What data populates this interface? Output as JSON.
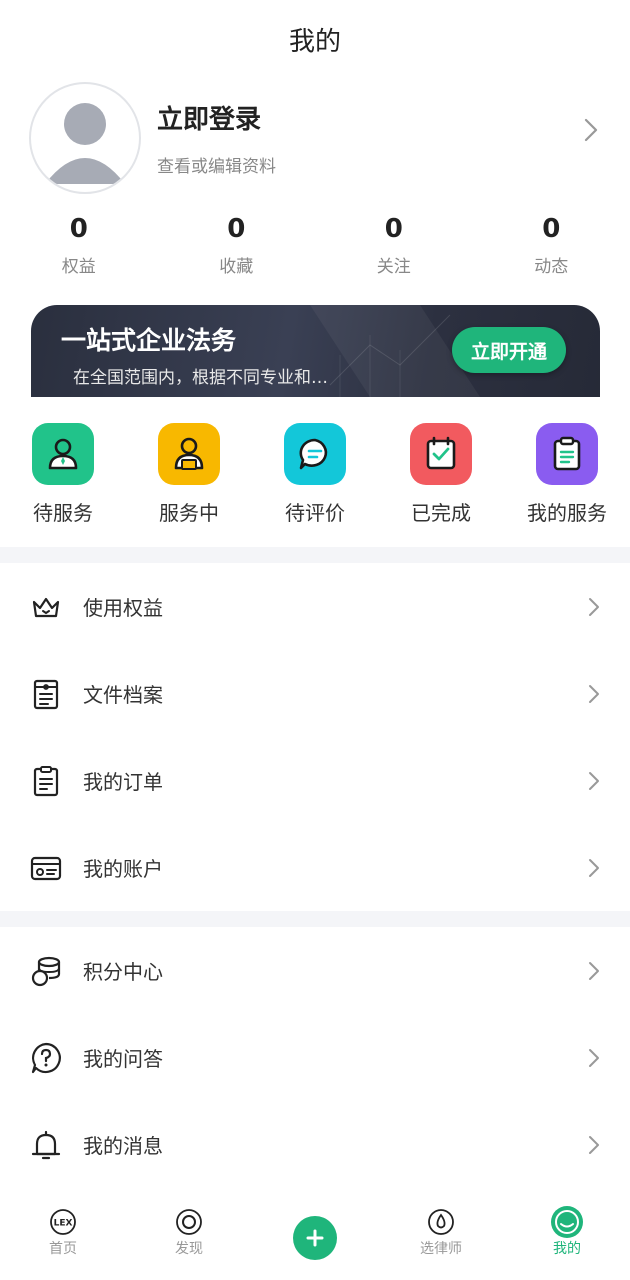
{
  "header": {
    "title": "我的"
  },
  "profile": {
    "login_title": "立即登录",
    "login_sub": "查看或编辑资料"
  },
  "stats": [
    {
      "value": "0",
      "label": "权益"
    },
    {
      "value": "0",
      "label": "收藏"
    },
    {
      "value": "0",
      "label": "关注"
    },
    {
      "value": "0",
      "label": "动态"
    }
  ],
  "banner": {
    "title": "一站式企业法务",
    "subtitle": "在全国范围内，根据不同专业和…",
    "button": "立即开通"
  },
  "services": [
    {
      "label": "待服务",
      "icon": "person-tie-icon",
      "color": "#21c38a"
    },
    {
      "label": "服务中",
      "icon": "person-laptop-icon",
      "color": "#f8b800"
    },
    {
      "label": "待评价",
      "icon": "chat-bubble-icon",
      "color": "#13c7d9"
    },
    {
      "label": "已完成",
      "icon": "calendar-check-icon",
      "color": "#f25a5f"
    },
    {
      "label": "我的服务",
      "icon": "clipboard-icon",
      "color": "#8a5cf0"
    }
  ],
  "menu_group1": [
    {
      "label": "使用权益",
      "icon": "crown-icon"
    },
    {
      "label": "文件档案",
      "icon": "file-archive-icon"
    },
    {
      "label": "我的订单",
      "icon": "order-clipboard-icon"
    },
    {
      "label": "我的账户",
      "icon": "account-card-icon"
    }
  ],
  "menu_group2": [
    {
      "label": "积分中心",
      "icon": "coins-icon"
    },
    {
      "label": "我的问答",
      "icon": "question-icon"
    },
    {
      "label": "我的消息",
      "icon": "bell-icon"
    }
  ],
  "tabbar": {
    "home": "首页",
    "discover": "发现",
    "lawyer": "选律师",
    "mine": "我的",
    "home_icon_text": "LEX",
    "active_color": "#1fb57b"
  }
}
